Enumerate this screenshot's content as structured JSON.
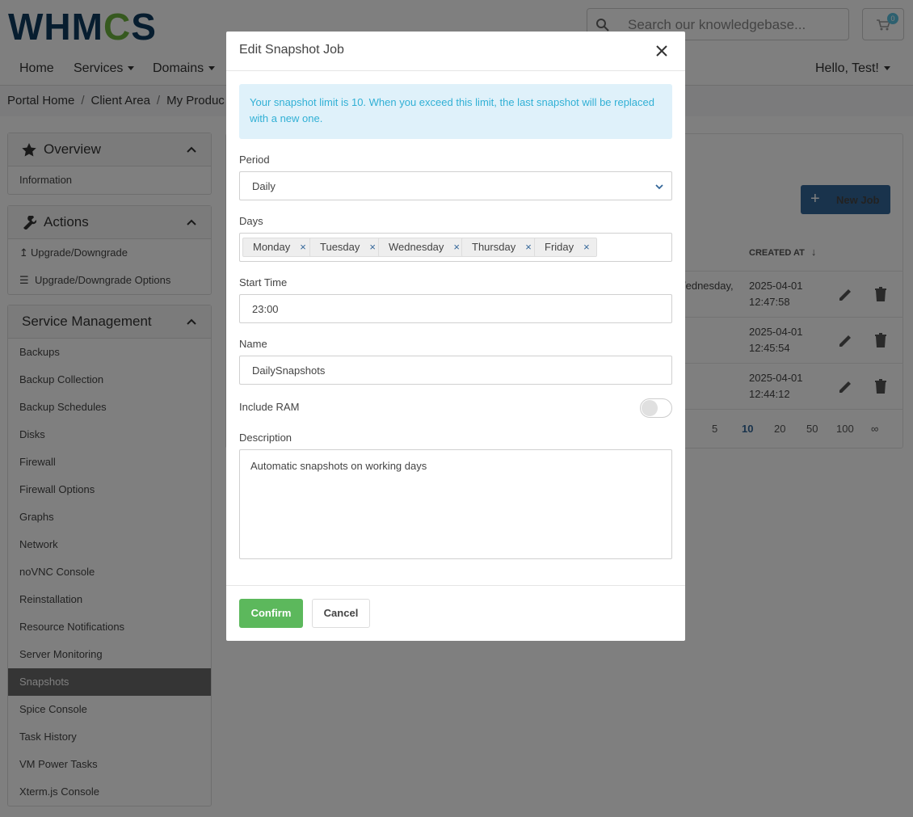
{
  "header": {
    "logo": "WHMCS",
    "search_placeholder": "Search our knowledgebase...",
    "cart_count": "0"
  },
  "nav": {
    "home": "Home",
    "services": "Services",
    "domains": "Domains",
    "user": "Hello, Test!"
  },
  "breadcrumb": {
    "home": "Portal Home",
    "client": "Client Area",
    "products": "My Produc"
  },
  "sidebar": {
    "overview": {
      "title": "Overview",
      "items": [
        "Information"
      ]
    },
    "actions": {
      "title": "Actions",
      "items": [
        "Upgrade/Downgrade",
        "Upgrade/Downgrade Options"
      ]
    },
    "management": {
      "title": "Service Management",
      "items": [
        "Backups",
        "Backup Collection",
        "Backup Schedules",
        "Disks",
        "Firewall",
        "Firewall Options",
        "Graphs",
        "Network",
        "noVNC Console",
        "Reinstallation",
        "Resource Notifications",
        "Server Monitoring",
        "Snapshots",
        "Spice Console",
        "Task History",
        "VM Power Tasks",
        "Xterm.js Console"
      ],
      "active": "Snapshots"
    }
  },
  "main": {
    "new_job": "New Job",
    "created_at_header": "CREATED AT",
    "rows": [
      {
        "days_fragment": "/ednesday,",
        "date": "2025-04-01",
        "time": "12:47:58"
      },
      {
        "days_fragment": "",
        "date": "2025-04-01",
        "time": "12:45:54"
      },
      {
        "days_fragment": "",
        "date": "2025-04-01",
        "time": "12:44:12"
      }
    ],
    "pager": [
      "5",
      "10",
      "20",
      "50",
      "100",
      "∞"
    ],
    "pager_active": "10"
  },
  "modal": {
    "title": "Edit Snapshot Job",
    "alert": "Your snapshot limit is 10. When you exceed this limit, the last snapshot will be replaced with a new one.",
    "period_label": "Period",
    "period_value": "Daily",
    "days_label": "Days",
    "days": [
      "Monday",
      "Tuesday",
      "Wednesday",
      "Thursday",
      "Friday"
    ],
    "start_time_label": "Start Time",
    "start_time_value": "23:00",
    "name_label": "Name",
    "name_value": "DailySnapshots",
    "include_ram_label": "Include RAM",
    "include_ram": false,
    "description_label": "Description",
    "description_value": "Automatic snapshots on working days",
    "confirm": "Confirm",
    "cancel": "Cancel"
  },
  "colors": {
    "primary": "#336699",
    "success": "#5cb85c",
    "info_bg": "#dff1fa",
    "info_text": "#31b0d5",
    "logo_blue": "#0f3b5f",
    "logo_green": "#6cb33f"
  },
  "icons": [
    "search-icon",
    "cart-icon",
    "star-icon",
    "wrench-icon",
    "arrow-up-icon",
    "list-icon",
    "chevron-up-icon",
    "pencil-icon",
    "trash-icon",
    "sort-arrow-icon",
    "close-icon",
    "chevron-down-icon",
    "plus-icon"
  ]
}
